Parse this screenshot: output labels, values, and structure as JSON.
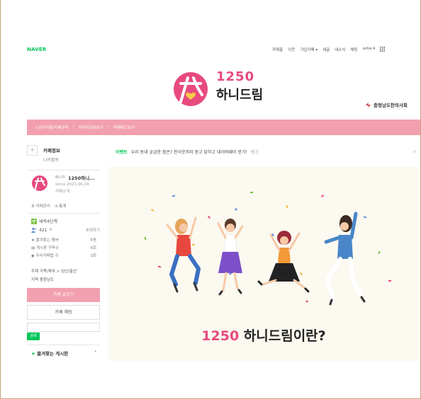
{
  "brand": {
    "naver": "NAVER",
    "cafe_number": "1250",
    "cafe_name": "하니드림",
    "sponsor": "충청남도한의사회",
    "accent_color": "#e84a7f",
    "bar_color": "#f2a0b0",
    "green": "#03c75a"
  },
  "gnb": {
    "items": [
      "카페홈",
      "이웃",
      "가입카페 ▾",
      "새글",
      "내소식",
      "채팅",
      "sohe ▾"
    ],
    "grid_icon": "grid-icon"
  },
  "topbar": {
    "links": [
      "▷공지사항/카페규칙",
      "이미지모아보기",
      "카페태그보기"
    ]
  },
  "sidebar": {
    "cafe_info": "카페정보",
    "my_activity": "나의활동",
    "manager_tag": "매니저",
    "cafe_title": "1250하니...",
    "since": "since 2021.06.24",
    "intro": "카페소개",
    "mgmt": [
      "⚙ 카페관리",
      "ılı 통계"
    ],
    "level": "새싹4단계",
    "members": "421",
    "invite": "초대하기",
    "stats": [
      {
        "label": "★ 즐겨찾는 멤버",
        "value": "5명"
      },
      {
        "label": "▤ 게시판 구독수",
        "value": "6회"
      },
      {
        "label": "◉ 우리카페앱 수",
        "value": "1회"
      }
    ],
    "topic": "주제 가족/육아 > 임신/출산",
    "region": "지역 충청남도",
    "write_button": "카페 글쓰기",
    "chat_button": "카페 채팅",
    "search_button": "검색",
    "fav_board": "즐겨찾는 게시판"
  },
  "notice": {
    "event": "이벤트",
    "text": "우리 동네 궁금한 점은? 친이웃끼리 묻고 답하고 네이버페이 받기!",
    "more": "링크"
  },
  "hero": {
    "title_accent": "1250",
    "title_rest": " 하니드림이란?"
  }
}
